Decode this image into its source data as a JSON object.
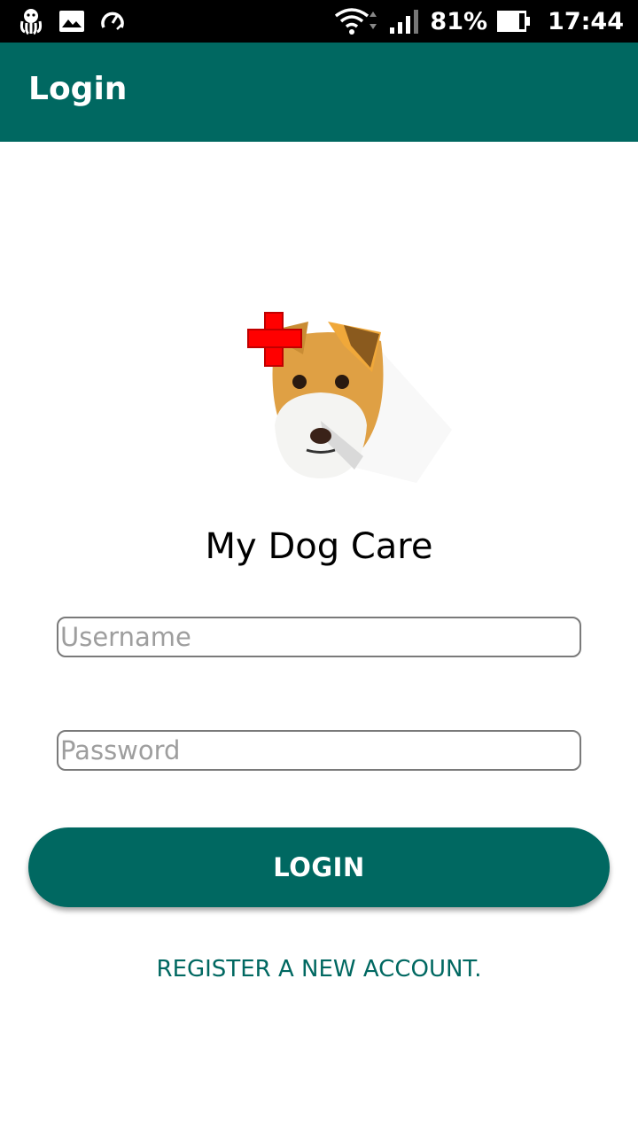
{
  "status_bar": {
    "battery": "81%",
    "time": "17:44",
    "icons": [
      "octopus-icon",
      "image-icon",
      "speed-icon",
      "wifi-icon",
      "signal-icon",
      "battery-icon"
    ]
  },
  "app_bar": {
    "title": "Login"
  },
  "logo": {
    "icon": "dog-first-aid-logo"
  },
  "app_name": "My Dog Care",
  "form": {
    "username_placeholder": "Username",
    "password_placeholder": "Password",
    "username_value": "",
    "password_value": ""
  },
  "actions": {
    "login_label": "LOGIN",
    "register_label": "REGISTER A NEW ACCOUNT."
  },
  "colors": {
    "primary": "#006861",
    "status_bar": "#000000",
    "background": "#ffffff",
    "cross": "#ff0000"
  }
}
